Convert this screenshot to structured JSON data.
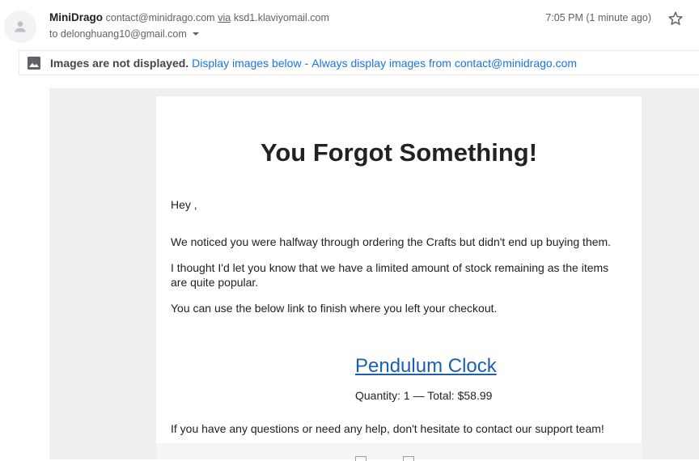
{
  "header": {
    "sender_name": "MiniDrago",
    "sender_email": "contact@minidrago.com",
    "via_label": "via",
    "via_domain": "ksd1.klaviyomail.com",
    "to_line": "to delonghuang10@gmail.com",
    "timestamp": "7:05 PM (1 minute ago)",
    "icons": {
      "avatar": "person-avatar-icon",
      "caret": "caret-down-icon",
      "star": "star-outline-icon"
    }
  },
  "images_bar": {
    "icon": "image-icon",
    "warning": "Images are not displayed.",
    "display_below": "Display images below",
    "separator": "-",
    "always_display": "Always display images from contact@minidrago.com"
  },
  "email": {
    "title": "You Forgot Something!",
    "greeting": "Hey ,",
    "paragraph1": "We noticed you were halfway through ordering the Crafts but didn't end up buying them.",
    "paragraph2": "I thought I'd let you know that we have a limited amount of stock remaining as the items are quite popular.",
    "paragraph3": "You can use the below link to finish where you left your checkout.",
    "product_name": "Pendulum Clock",
    "product_meta": "Quantity: 1 — Total: $58.99",
    "support": "If you have any questions or need any help, don't hesitate to contact our support team!"
  },
  "colors": {
    "link": "#1a73e8",
    "product_link": "#1a5fb4",
    "email_background": "#efefef",
    "text": "#222222"
  }
}
